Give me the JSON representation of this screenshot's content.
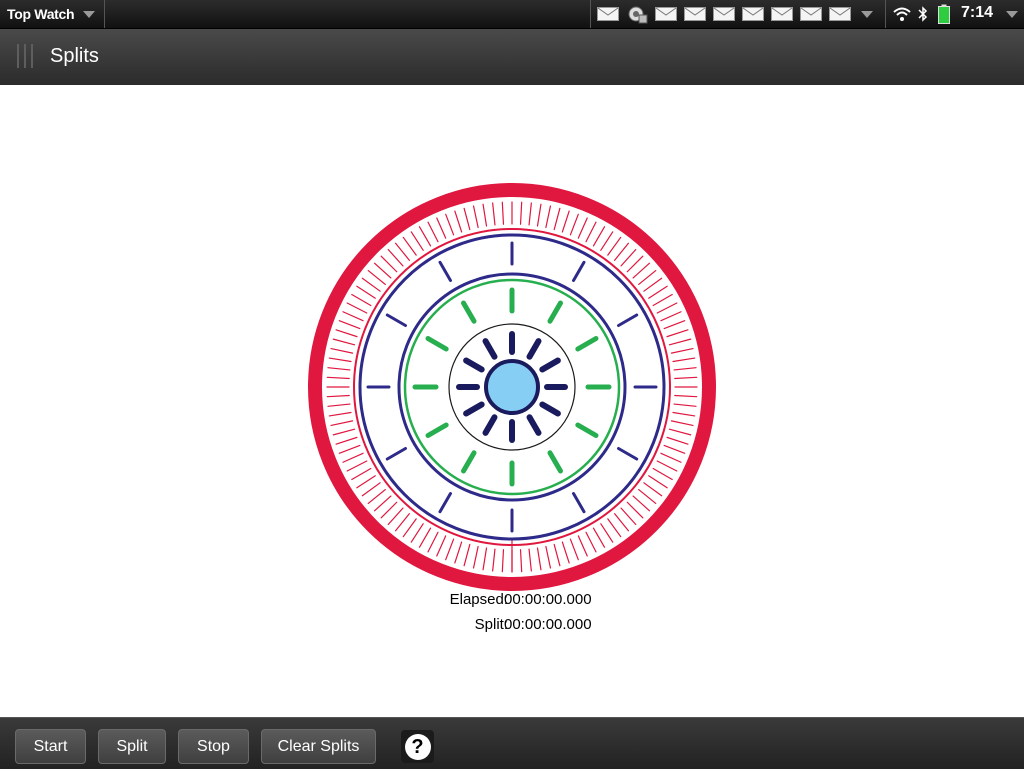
{
  "statusbar": {
    "app_title": "Top Watch",
    "notifications": [
      "mail-icon",
      "mail-icon",
      "mail-icon",
      "mail-icon",
      "mail-icon",
      "mail-icon",
      "mail-icon",
      "mail-icon",
      "mail-icon"
    ],
    "clock": "7:14",
    "battery_color": "#2ecc40"
  },
  "header": {
    "title": "Splits"
  },
  "stopwatch": {
    "elapsed_label": "Elapsed:",
    "elapsed_value": "00:00:00.000",
    "split_label": "Split:",
    "split_value": "00:00:00.000",
    "colors": {
      "outer_ring": "#e0173f",
      "blue_ring": "#2e2a8a",
      "green_ring": "#27ae4f",
      "hub_ticks": "#1a1a5e",
      "hub_center": "#87cef5"
    }
  },
  "toolbar": {
    "start_label": "Start",
    "split_label": "Split",
    "stop_label": "Stop",
    "clear_label": "Clear Splits",
    "help_label": "?"
  }
}
